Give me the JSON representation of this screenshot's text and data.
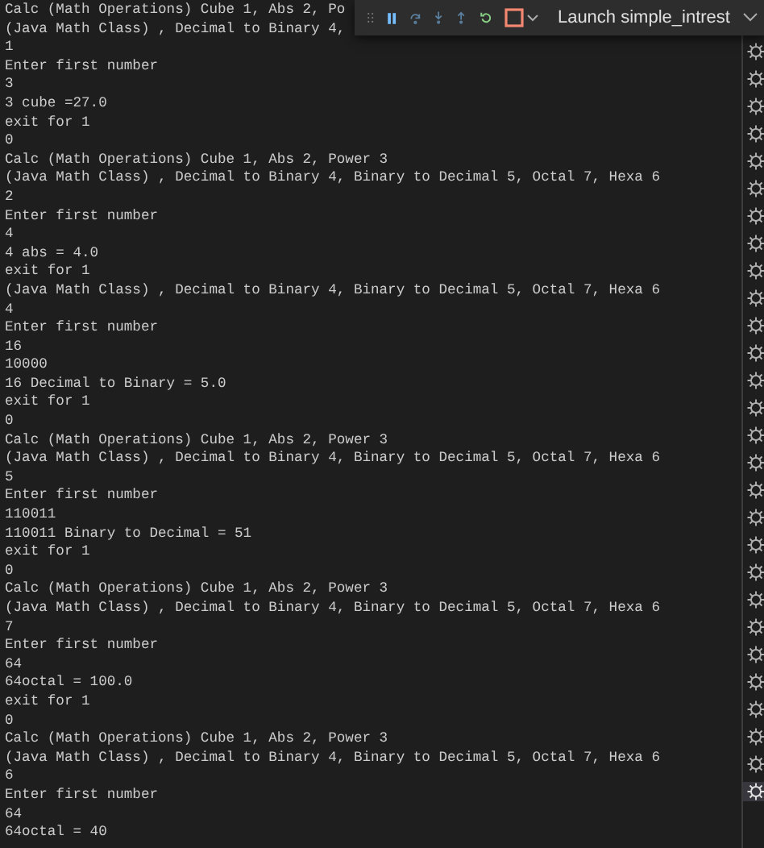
{
  "debug_toolbar": {
    "launch_config": "Launch simple_intrest"
  },
  "terminal_output": [
    "Calc (Math Operations) Cube 1, Abs 2, Po",
    "(Java Math Class) , Decimal to Binary 4,",
    "1",
    "Enter first number",
    "3",
    "3 cube =27.0",
    "exit for 1",
    "0",
    "Calc (Math Operations) Cube 1, Abs 2, Power 3",
    "(Java Math Class) , Decimal to Binary 4, Binary to Decimal 5, Octal 7, Hexa 6",
    "2",
    "Enter first number",
    "4",
    "4 abs = 4.0",
    "exit for 1",
    "(Java Math Class) , Decimal to Binary 4, Binary to Decimal 5, Octal 7, Hexa 6",
    "4",
    "Enter first number",
    "16",
    "10000",
    "16 Decimal to Binary = 5.0",
    "exit for 1",
    "0",
    "Calc (Math Operations) Cube 1, Abs 2, Power 3",
    "(Java Math Class) , Decimal to Binary 4, Binary to Decimal 5, Octal 7, Hexa 6",
    "5",
    "Enter first number",
    "110011",
    "110011 Binary to Decimal = 51",
    "exit for 1",
    "0",
    "Calc (Math Operations) Cube 1, Abs 2, Power 3",
    "(Java Math Class) , Decimal to Binary 4, Binary to Decimal 5, Octal 7, Hexa 6",
    "7",
    "Enter first number",
    "64",
    "64octal = 100.0",
    "exit for 1",
    "0",
    "Calc (Math Operations) Cube 1, Abs 2, Power 3",
    "(Java Math Class) , Decimal to Binary 4, Binary to Decimal 5, Octal 7, Hexa 6",
    "6",
    "Enter first number",
    "64",
    "64octal = 40"
  ],
  "terminal_tabs": [
    {
      "selected": false
    },
    {
      "selected": false
    },
    {
      "selected": false
    },
    {
      "selected": false
    },
    {
      "selected": false
    },
    {
      "selected": false
    },
    {
      "selected": false
    },
    {
      "selected": false
    },
    {
      "selected": false
    },
    {
      "selected": false
    },
    {
      "selected": false
    },
    {
      "selected": false
    },
    {
      "selected": false
    },
    {
      "selected": false
    },
    {
      "selected": false
    },
    {
      "selected": false
    },
    {
      "selected": false
    },
    {
      "selected": false
    },
    {
      "selected": false
    },
    {
      "selected": false
    },
    {
      "selected": false
    },
    {
      "selected": false
    },
    {
      "selected": false
    },
    {
      "selected": false
    },
    {
      "selected": false
    },
    {
      "selected": false
    },
    {
      "selected": false
    },
    {
      "selected": true
    }
  ]
}
